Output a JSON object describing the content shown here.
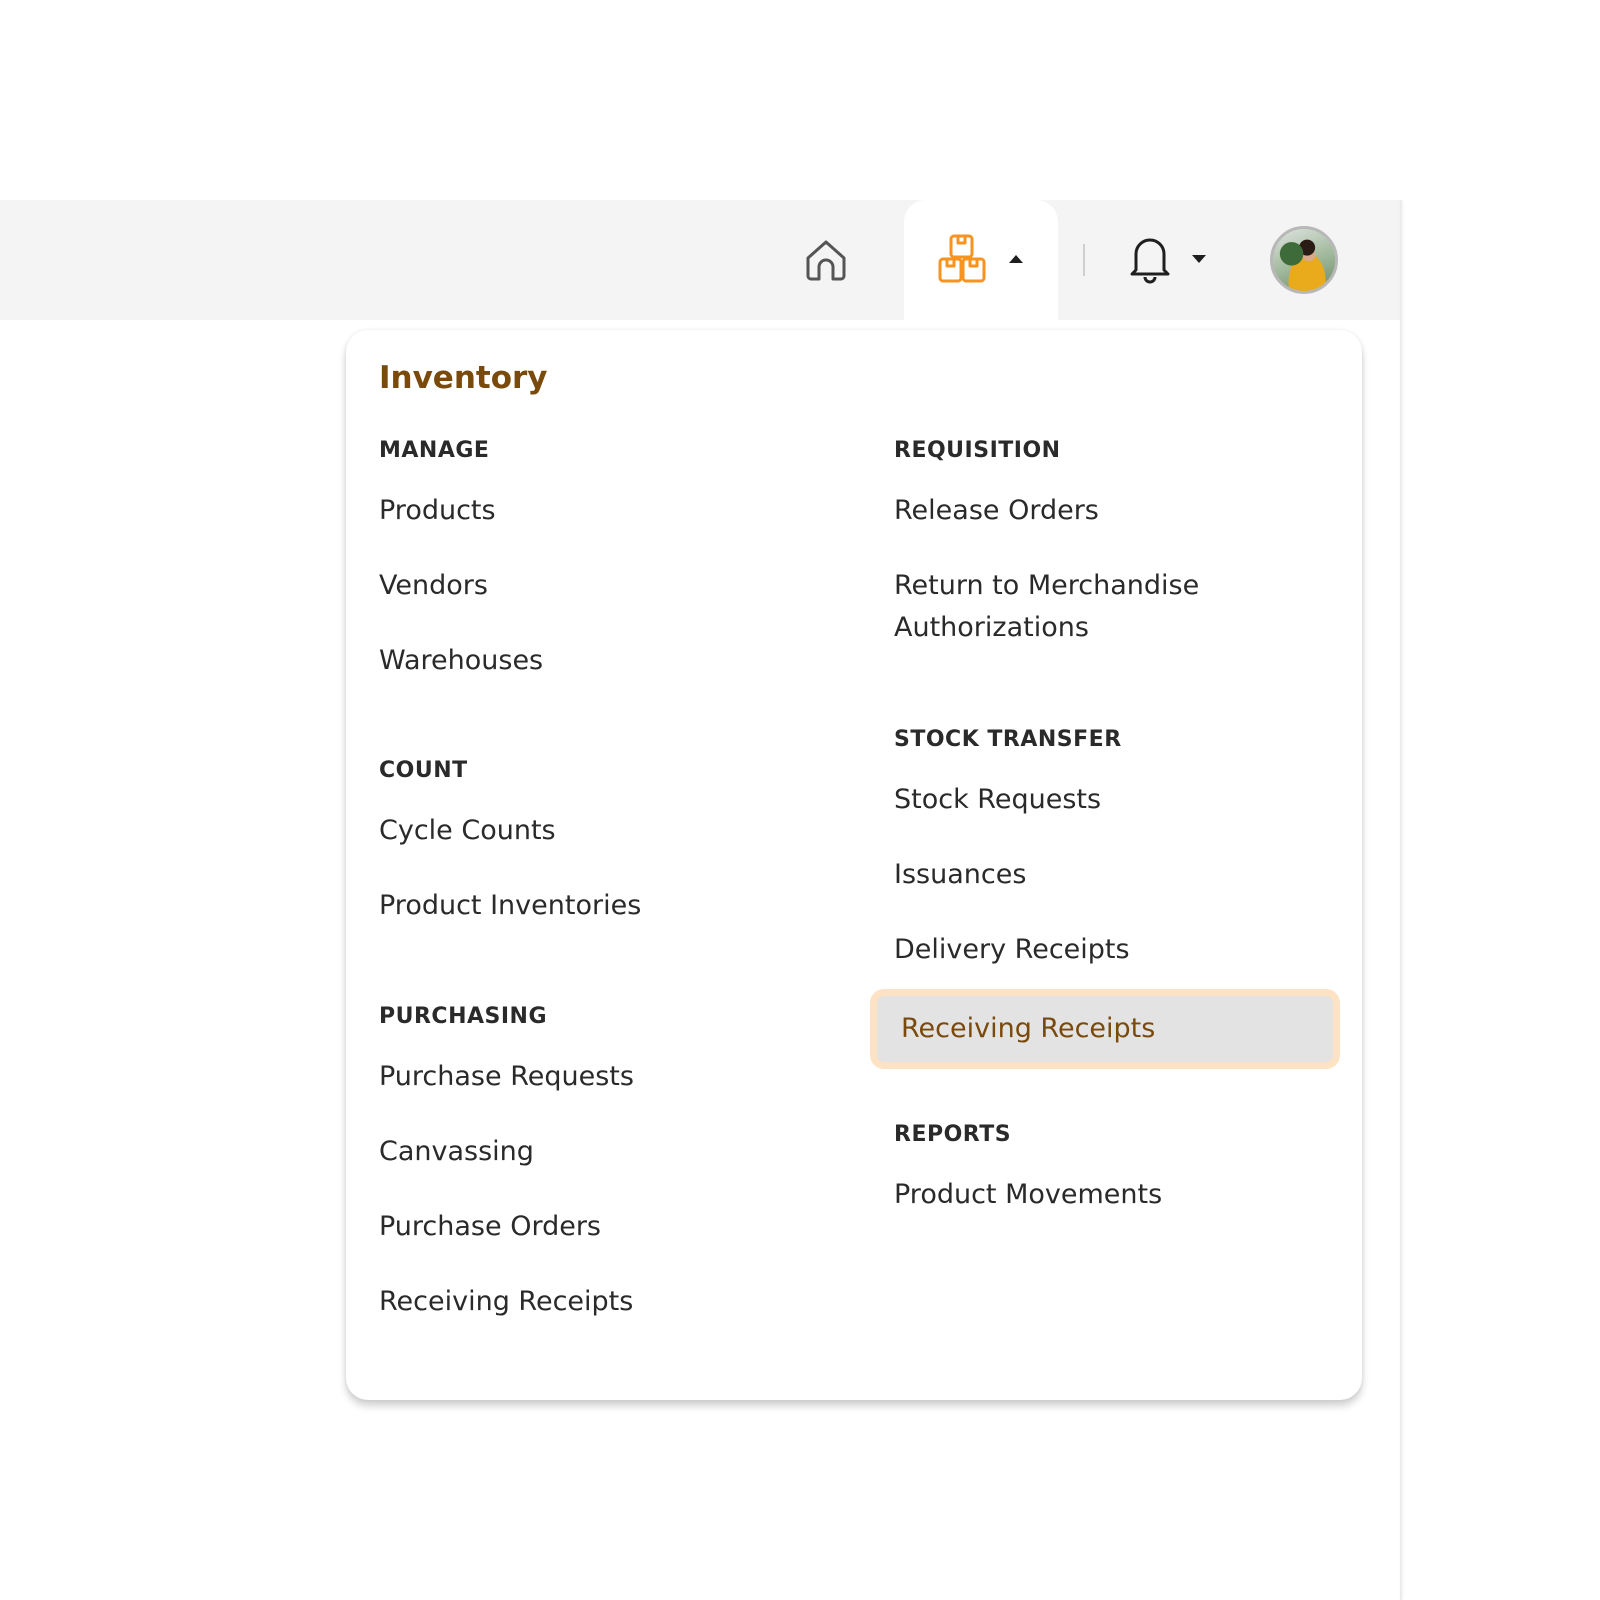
{
  "topbar": {
    "home_icon": "home-icon",
    "inventory_icon": "boxes-stack-icon",
    "inventory_caret": "caret-up-icon",
    "notifications_icon": "bell-icon",
    "notifications_caret": "caret-down-icon",
    "avatar": "user-avatar"
  },
  "colors": {
    "accent_orange": "#f7931e",
    "title_brown": "#7a4a0c",
    "active_bg": "#e3e3e3",
    "active_ring": "#fde2c4",
    "topbar_bg": "#f4f4f4"
  },
  "dropdown": {
    "title": "Inventory",
    "left_sections": [
      {
        "heading": "MANAGE",
        "items": [
          "Products",
          "Vendors",
          "Warehouses"
        ]
      },
      {
        "heading": "COUNT",
        "items": [
          "Cycle Counts",
          "Product Inventories"
        ]
      },
      {
        "heading": "PURCHASING",
        "items": [
          "Purchase Requests",
          "Canvassing",
          "Purchase Orders",
          "Receiving Receipts"
        ]
      }
    ],
    "right_sections": [
      {
        "heading": "REQUISITION",
        "items": [
          "Release Orders",
          "Return to Merchandise Authorizations"
        ]
      },
      {
        "heading": "STOCK TRANSFER",
        "items": [
          "Stock Requests",
          "Issuances",
          "Delivery Receipts",
          "Receiving Receipts"
        ]
      },
      {
        "heading": "REPORTS",
        "items": [
          "Product Movements"
        ]
      }
    ],
    "active_item": "Receiving Receipts (Stock Transfer)"
  }
}
